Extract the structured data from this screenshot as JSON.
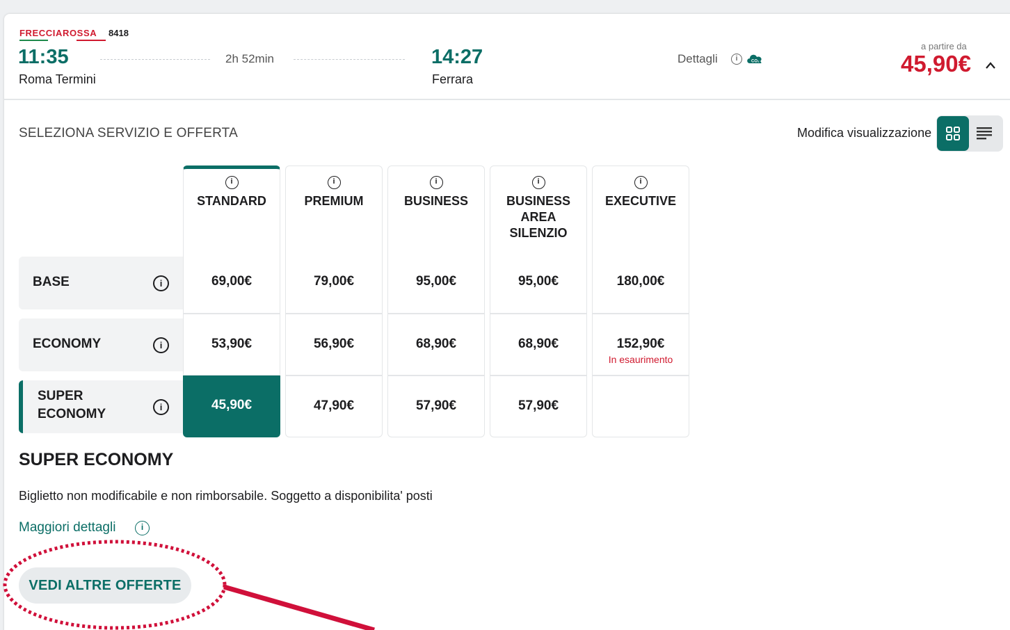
{
  "train": {
    "brand": "FRECCIAROSSA",
    "number": "8418",
    "departure_time": "11:35",
    "departure_station": "Roma Termini",
    "duration": "2h 52min",
    "arrival_time": "14:27",
    "arrival_station": "Ferrara",
    "details_label": "Dettagli",
    "co2_label": "CO₂",
    "from_label": "a partire da",
    "from_price": "45,90€"
  },
  "selection": {
    "title": "SELEZIONA SERVIZIO E OFFERTA",
    "view_label": "Modifica visualizzazione"
  },
  "services": [
    {
      "label": "STANDARD"
    },
    {
      "label": "PREMIUM"
    },
    {
      "label": "BUSINESS"
    },
    {
      "label": "BUSINESS AREA SILENZIO"
    },
    {
      "label": "EXECUTIVE"
    }
  ],
  "offers": [
    {
      "label": "BASE",
      "prices": [
        "69,00€",
        "79,00€",
        "95,00€",
        "95,00€",
        "180,00€"
      ]
    },
    {
      "label": "ECONOMY",
      "prices": [
        "53,90€",
        "56,90€",
        "68,90€",
        "68,90€",
        "152,90€"
      ],
      "note": "In esaurimento"
    },
    {
      "label": "SUPER ECONOMY",
      "prices": [
        "45,90€",
        "47,90€",
        "57,90€",
        "57,90€",
        ""
      ]
    }
  ],
  "selected_offer": {
    "title": "SUPER ECONOMY",
    "description": "Biglietto non modificabile e non rimborsabile. Soggetto a disponibilita' posti",
    "more_link": "Maggiori dettagli",
    "more_offers_button": "VEDI ALTRE OFFERTE"
  },
  "colors": {
    "accent": "#0b6e66",
    "price_red": "#d01a2f",
    "annotation": "#d0103a"
  }
}
